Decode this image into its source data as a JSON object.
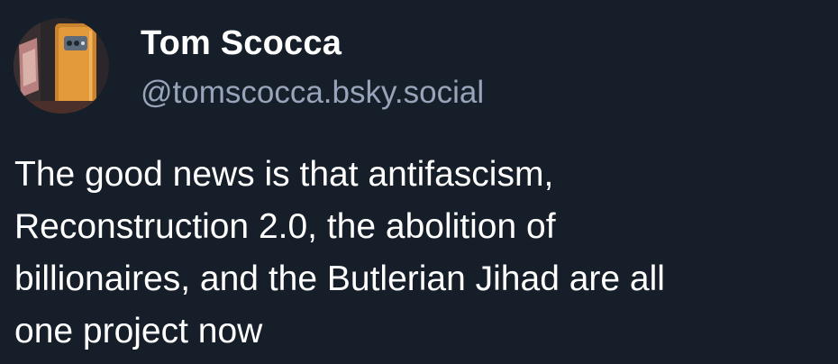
{
  "author": {
    "display_name": "Tom Scocca",
    "handle": "@tomscocca.bsky.social",
    "avatar_icon": "avatar-photo"
  },
  "post": {
    "text_lines": [
      "The good news is that antifascism,",
      "Reconstruction 2.0, the abolition of",
      "billionaires, and the Butlerian Jihad are all",
      "one project now"
    ]
  },
  "colors": {
    "background": "#161e29",
    "name": "#ffffff",
    "handle": "#97a4b9",
    "text": "#ffffff"
  }
}
